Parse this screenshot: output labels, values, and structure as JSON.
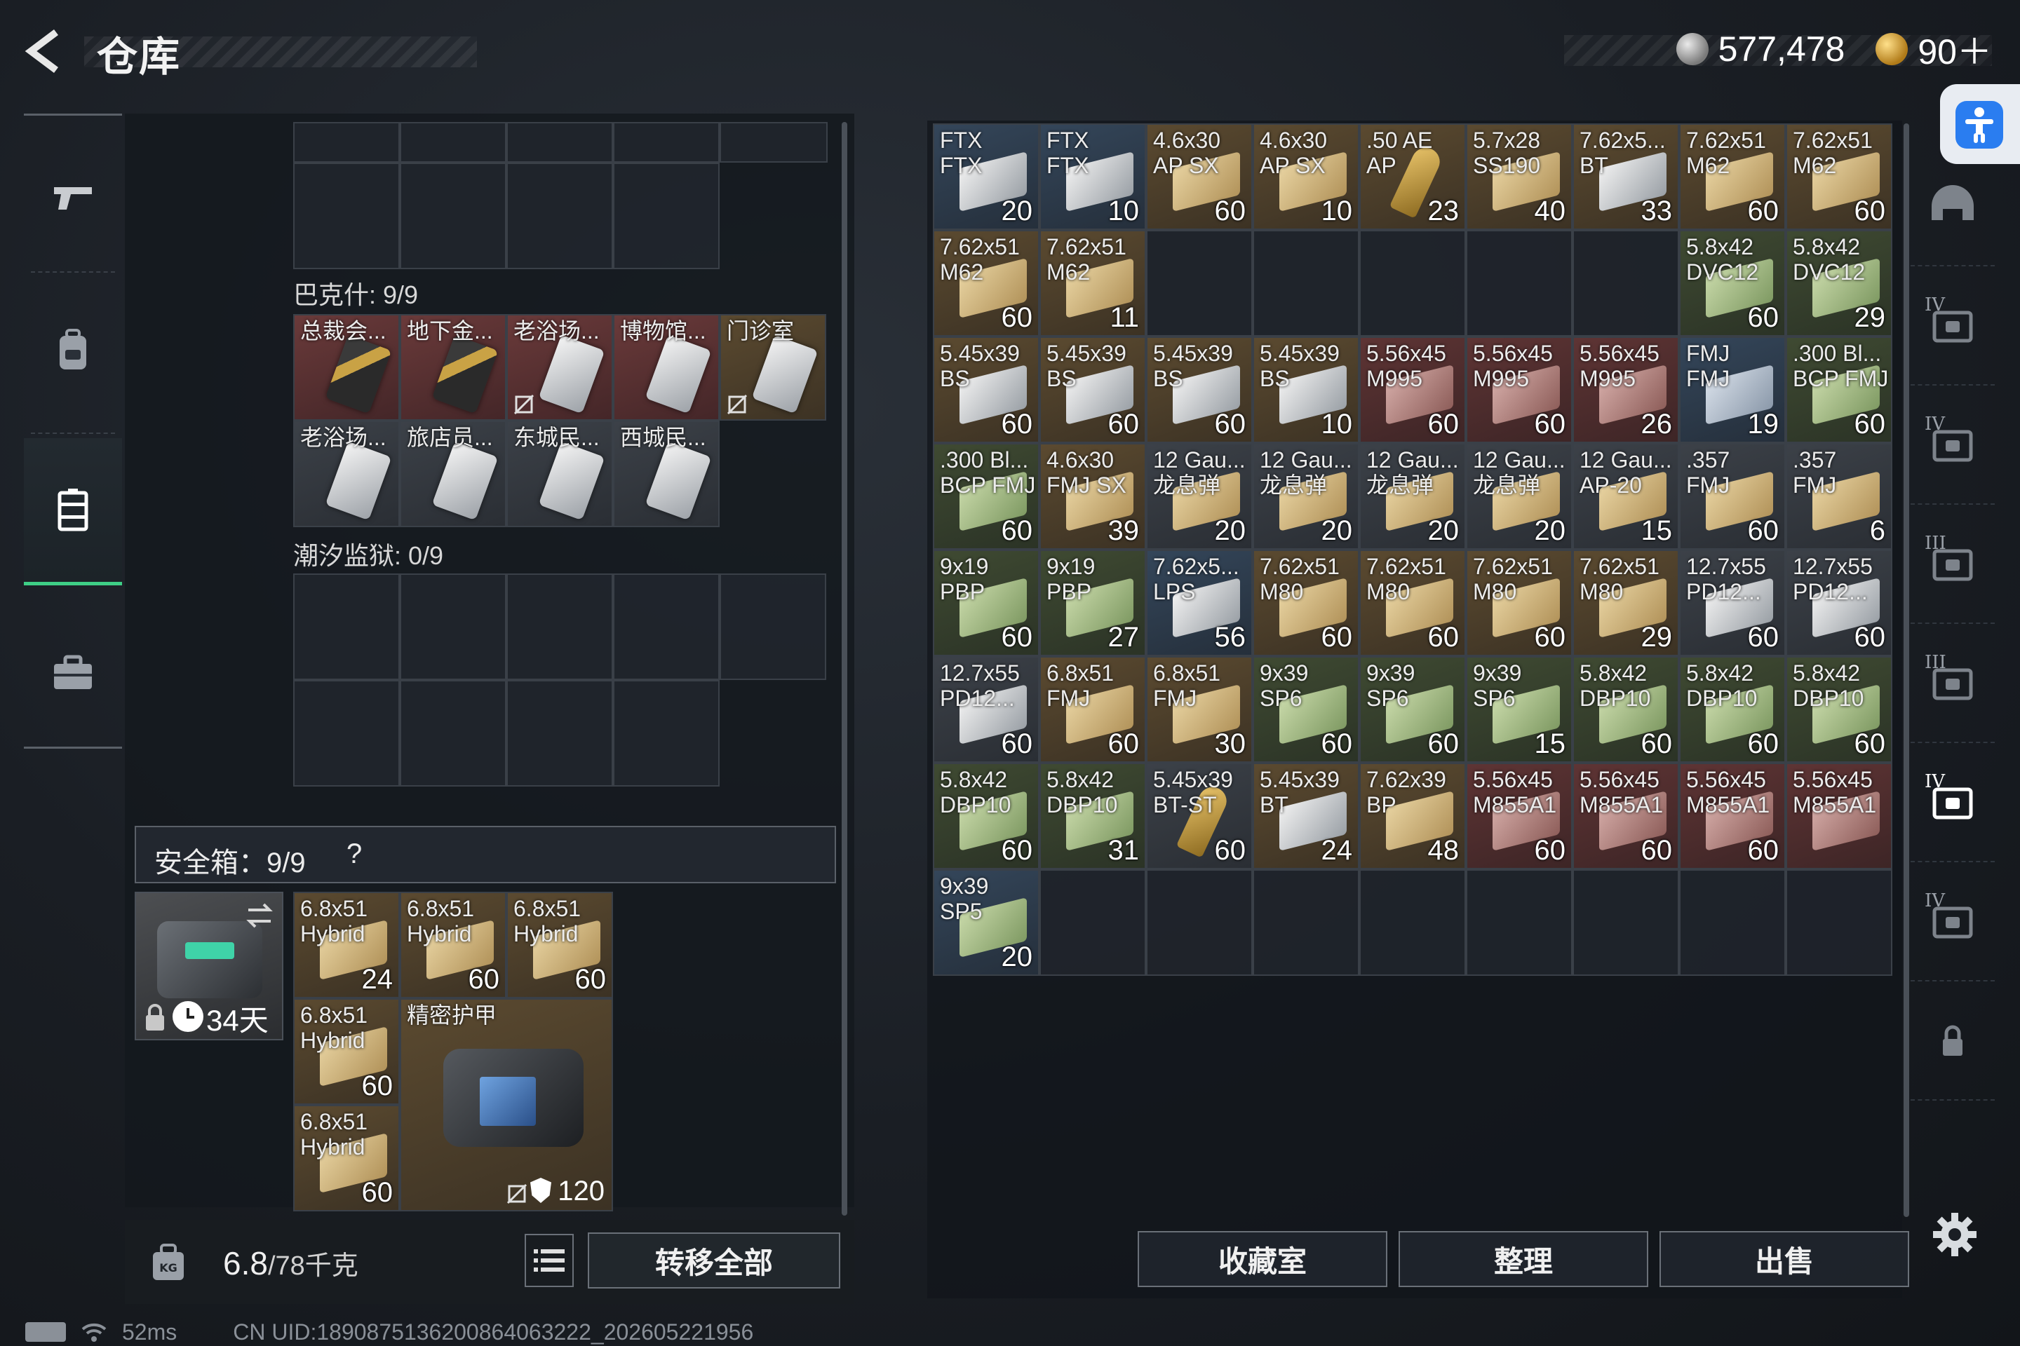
{
  "title": "仓库",
  "currency": {
    "silver": "577,478",
    "gold": "90＋"
  },
  "left": {
    "bakshi_title": "巴克什: 9/9",
    "bakshi_items": [
      {
        "name": "总裁会...",
        "tone": "red",
        "card": "gold",
        "locked": false
      },
      {
        "name": "地下金...",
        "tone": "red",
        "card": "gold",
        "locked": false
      },
      {
        "name": "老浴场...",
        "tone": "red",
        "card": "silver",
        "locked": true
      },
      {
        "name": "博物馆...",
        "tone": "red",
        "card": "silver",
        "locked": false
      },
      {
        "name": "门诊室",
        "tone": "tan",
        "card": "silver",
        "locked": true
      },
      {
        "name": "老浴场...",
        "tone": "grey",
        "card": "silver",
        "locked": false
      },
      {
        "name": "旅店员...",
        "tone": "grey",
        "card": "silver",
        "locked": false
      },
      {
        "name": "东城民...",
        "tone": "grey",
        "card": "silver",
        "locked": false
      },
      {
        "name": "西城民...",
        "tone": "grey",
        "card": "silver",
        "locked": false
      }
    ],
    "tidal_title": "潮汐监狱: 0/9",
    "safe_title": "安全箱：9/9",
    "safe_help": "?",
    "safe_days": "34天",
    "safe_items": [
      {
        "name": "6.8x51\nHybrid",
        "count": "24"
      },
      {
        "name": "6.8x51\nHybrid",
        "count": "60"
      },
      {
        "name": "6.8x51\nHybrid",
        "count": "60"
      },
      {
        "name": "6.8x51\nHybrid",
        "count": "60"
      },
      {
        "name": "6.8x51\nHybrid",
        "count": "60"
      }
    ],
    "armor": {
      "name": "精密护甲",
      "durability": "120"
    },
    "weight": "6.8",
    "weight_max": "/78千克",
    "transfer_all": "转移全部"
  },
  "status": {
    "ping": "52ms",
    "uid": "CN UID:1890875136200864063222_202605221956"
  },
  "ammo": [
    {
      "name": "FTX\nFTX",
      "count": "20",
      "tone": "blue",
      "box": "silver"
    },
    {
      "name": "FTX\nFTX",
      "count": "10",
      "tone": "blue",
      "box": "silver"
    },
    {
      "name": "4.6x30\nAP SX",
      "count": "60",
      "tone": "tan",
      "box": "tan"
    },
    {
      "name": "4.6x30\nAP SX",
      "count": "10",
      "tone": "tan",
      "box": "tan"
    },
    {
      "name": ".50 AE\nAP",
      "count": "23",
      "tone": "tan",
      "box": "bullet"
    },
    {
      "name": "5.7x28\nSS190",
      "count": "40",
      "tone": "tan",
      "box": "tan"
    },
    {
      "name": "7.62x5...\nBT",
      "count": "33",
      "tone": "tan",
      "box": "silver"
    },
    {
      "name": "7.62x51\nM62",
      "count": "60",
      "tone": "tan",
      "box": "tan"
    },
    {
      "name": "7.62x51\nM62",
      "count": "60",
      "tone": "tan",
      "box": "tan"
    },
    {
      "name": "7.62x51\nM62",
      "count": "60",
      "tone": "tan",
      "box": "tan"
    },
    {
      "name": "7.62x51\nM62",
      "count": "11",
      "tone": "tan",
      "box": "tan"
    },
    null,
    null,
    null,
    null,
    null,
    {
      "name": "5.8x42\nDVC12",
      "count": "60",
      "tone": "olive",
      "box": "green"
    },
    {
      "name": "5.8x42\nDVC12",
      "count": "29",
      "tone": "olive",
      "box": "green"
    },
    {
      "name": "5.45x39\nBS",
      "count": "60",
      "tone": "tan",
      "box": "silver"
    },
    {
      "name": "5.45x39\nBS",
      "count": "60",
      "tone": "tan",
      "box": "silver"
    },
    {
      "name": "5.45x39\nBS",
      "count": "60",
      "tone": "tan",
      "box": "silver"
    },
    {
      "name": "5.45x39\nBS",
      "count": "10",
      "tone": "tan",
      "box": "silver"
    },
    {
      "name": "5.56x45\nM995",
      "count": "60",
      "tone": "red",
      "box": "red"
    },
    {
      "name": "5.56x45\nM995",
      "count": "60",
      "tone": "red",
      "box": "red"
    },
    {
      "name": "5.56x45\nM995",
      "count": "26",
      "tone": "red",
      "box": "red"
    },
    {
      "name": "FMJ\nFMJ",
      "count": "19",
      "tone": "blue",
      "box": "blue"
    },
    {
      "name": ".300 Bl...\nBCP FMJ",
      "count": "60",
      "tone": "olive",
      "box": "green"
    },
    {
      "name": ".300 Bl...\nBCP FMJ",
      "count": "60",
      "tone": "olive",
      "box": "green"
    },
    {
      "name": "4.6x30\nFMJ SX",
      "count": "39",
      "tone": "tan",
      "box": "tan"
    },
    {
      "name": "12 Gau...\n龙息弹",
      "count": "20",
      "tone": "grey",
      "box": "tan"
    },
    {
      "name": "12 Gau...\n龙息弹",
      "count": "20",
      "tone": "grey",
      "box": "tan"
    },
    {
      "name": "12 Gau...\n龙息弹",
      "count": "20",
      "tone": "grey",
      "box": "tan"
    },
    {
      "name": "12 Gau...\n龙息弹",
      "count": "20",
      "tone": "grey",
      "box": "tan"
    },
    {
      "name": "12 Gau...\nAP-20",
      "count": "15",
      "tone": "grey",
      "box": "tan"
    },
    {
      "name": ".357\nFMJ",
      "count": "60",
      "tone": "grey",
      "box": "tan"
    },
    {
      "name": ".357\nFMJ",
      "count": "6",
      "tone": "grey",
      "box": "tan"
    },
    {
      "name": "9x19\nPBP",
      "count": "60",
      "tone": "olive",
      "box": "green"
    },
    {
      "name": "9x19\nPBP",
      "count": "27",
      "tone": "olive",
      "box": "green"
    },
    {
      "name": "7.62x5...\nLPS",
      "count": "56",
      "tone": "blue",
      "box": "silver"
    },
    {
      "name": "7.62x51\nM80",
      "count": "60",
      "tone": "tan",
      "box": "tan"
    },
    {
      "name": "7.62x51\nM80",
      "count": "60",
      "tone": "tan",
      "box": "tan"
    },
    {
      "name": "7.62x51\nM80",
      "count": "60",
      "tone": "tan",
      "box": "tan"
    },
    {
      "name": "7.62x51\nM80",
      "count": "29",
      "tone": "tan",
      "box": "tan"
    },
    {
      "name": "12.7x55\nPD12...",
      "count": "60",
      "tone": "grey",
      "box": "silver"
    },
    {
      "name": "12.7x55\nPD12...",
      "count": "60",
      "tone": "grey",
      "box": "silver"
    },
    {
      "name": "12.7x55\nPD12...",
      "count": "60",
      "tone": "grey",
      "box": "silver"
    },
    {
      "name": "6.8x51\nFMJ",
      "count": "60",
      "tone": "tan",
      "box": "tan"
    },
    {
      "name": "6.8x51\nFMJ",
      "count": "30",
      "tone": "tan",
      "box": "tan"
    },
    {
      "name": "9x39\nSP6",
      "count": "60",
      "tone": "olive",
      "box": "green"
    },
    {
      "name": "9x39\nSP6",
      "count": "60",
      "tone": "olive",
      "box": "green"
    },
    {
      "name": "9x39\nSP6",
      "count": "15",
      "tone": "olive",
      "box": "green"
    },
    {
      "name": "5.8x42\nDBP10",
      "count": "60",
      "tone": "olive",
      "box": "green"
    },
    {
      "name": "5.8x42\nDBP10",
      "count": "60",
      "tone": "olive",
      "box": "green"
    },
    {
      "name": "5.8x42\nDBP10",
      "count": "60",
      "tone": "olive",
      "box": "green"
    },
    {
      "name": "5.8x42\nDBP10",
      "count": "60",
      "tone": "olive",
      "box": "green"
    },
    {
      "name": "5.8x42\nDBP10",
      "count": "31",
      "tone": "olive",
      "box": "green"
    },
    {
      "name": "5.45x39\nBT-ST",
      "count": "60",
      "tone": "grey",
      "box": "bullet"
    },
    {
      "name": "5.45x39\nBT",
      "count": "24",
      "tone": "tan",
      "box": "silver"
    },
    {
      "name": "7.62x39\nBP",
      "count": "48",
      "tone": "tan",
      "box": "tan"
    },
    {
      "name": "5.56x45\nM855A1",
      "count": "60",
      "tone": "red",
      "box": "red"
    },
    {
      "name": "5.56x45\nM855A1",
      "count": "60",
      "tone": "red",
      "box": "red"
    },
    {
      "name": "5.56x45\nM855A1",
      "count": "60",
      "tone": "red",
      "box": "red"
    },
    {
      "name": "5.56x45\nM855A1",
      "count": "",
      "tone": "red",
      "box": "red"
    },
    {
      "name": "9x39\nSP5",
      "count": "20",
      "tone": "blue",
      "box": "green"
    }
  ],
  "buttons": {
    "collection": "收藏室",
    "organize": "整理",
    "sell": "出售"
  },
  "right_tabs": [
    "",
    "IV",
    "IV",
    "III",
    "III",
    "IV",
    "IV",
    ""
  ],
  "colors": {
    "accent_green": "#3ecf86",
    "accessibility_blue": "#2a7df0"
  }
}
